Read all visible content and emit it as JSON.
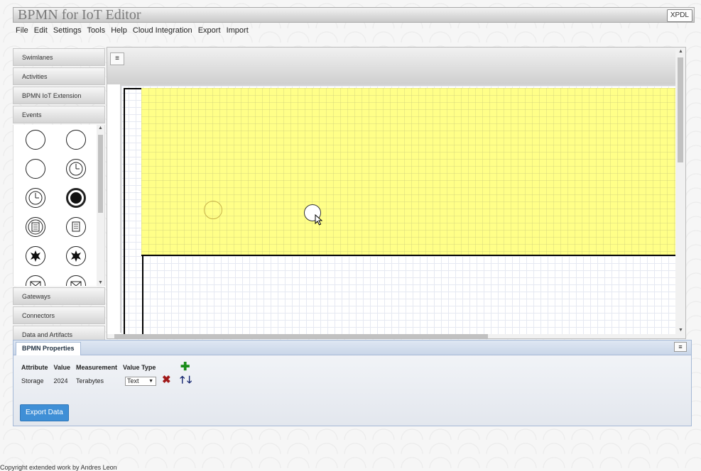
{
  "app": {
    "title": "BPMN for IoT Editor",
    "xpdl_label": "XPDL"
  },
  "menu": [
    "File",
    "Edit",
    "Settings",
    "Tools",
    "Help",
    "Cloud Integration",
    "Export",
    "Import"
  ],
  "sidebar": {
    "top_sections": [
      "Swimlanes",
      "Activities",
      "BPMN IoT Extension",
      "Events"
    ],
    "bottom_sections": [
      "Gateways",
      "Connectors",
      "Data and Artifacts"
    ],
    "event_icons": [
      "start-event-icon",
      "start-event-alt-icon",
      "intermediate-event-icon",
      "timer-event-icon",
      "timer-start-event-icon",
      "end-event-icon",
      "conditional-event-icon",
      "conditional-intermediate-event-icon",
      "multiple-event-icon",
      "multiple-intermediate-event-icon",
      "message-event-icon",
      "message-intermediate-event-icon"
    ]
  },
  "canvas": {
    "toolbar_icon": "≡"
  },
  "properties": {
    "tab_label": "BPMN Properties",
    "panel_button": "≡",
    "columns": [
      "Attribute",
      "Value",
      "Measurement",
      "Value Type"
    ],
    "rows": [
      {
        "attribute": "Storage",
        "value": "2024",
        "measurement": "Terabytes",
        "value_type": "Text"
      }
    ],
    "export_label": "Export Data"
  },
  "footer": {
    "copyright": "Copyright extended work by Andres Leon"
  }
}
